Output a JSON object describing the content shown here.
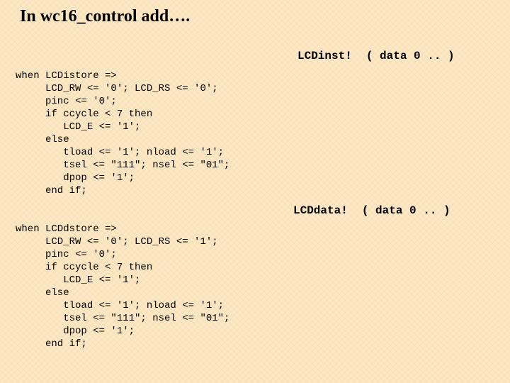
{
  "title": "In wc16_control  add….",
  "labels": {
    "l1": {
      "name": "LCDinst!",
      "paren": "( data 0 .. )"
    },
    "l2": {
      "name": "LCDdata!",
      "paren": "( data 0 .. )"
    }
  },
  "code": {
    "block1": "when LCDistore =>\n     LCD_RW <= '0'; LCD_RS <= '0';\n     pinc <= '0';\n     if ccycle < 7 then\n        LCD_E <= '1';\n     else\n        tload <= '1'; nload <= '1';\n        tsel <= \"111\"; nsel <= \"01\";\n        dpop <= '1';\n     end if;",
    "block2": "when LCDdstore =>\n     LCD_RW <= '0'; LCD_RS <= '1';\n     pinc <= '0';\n     if ccycle < 7 then\n        LCD_E <= '1';\n     else\n        tload <= '1'; nload <= '1';\n        tsel <= \"111\"; nsel <= \"01\";\n        dpop <= '1';\n     end if;"
  }
}
